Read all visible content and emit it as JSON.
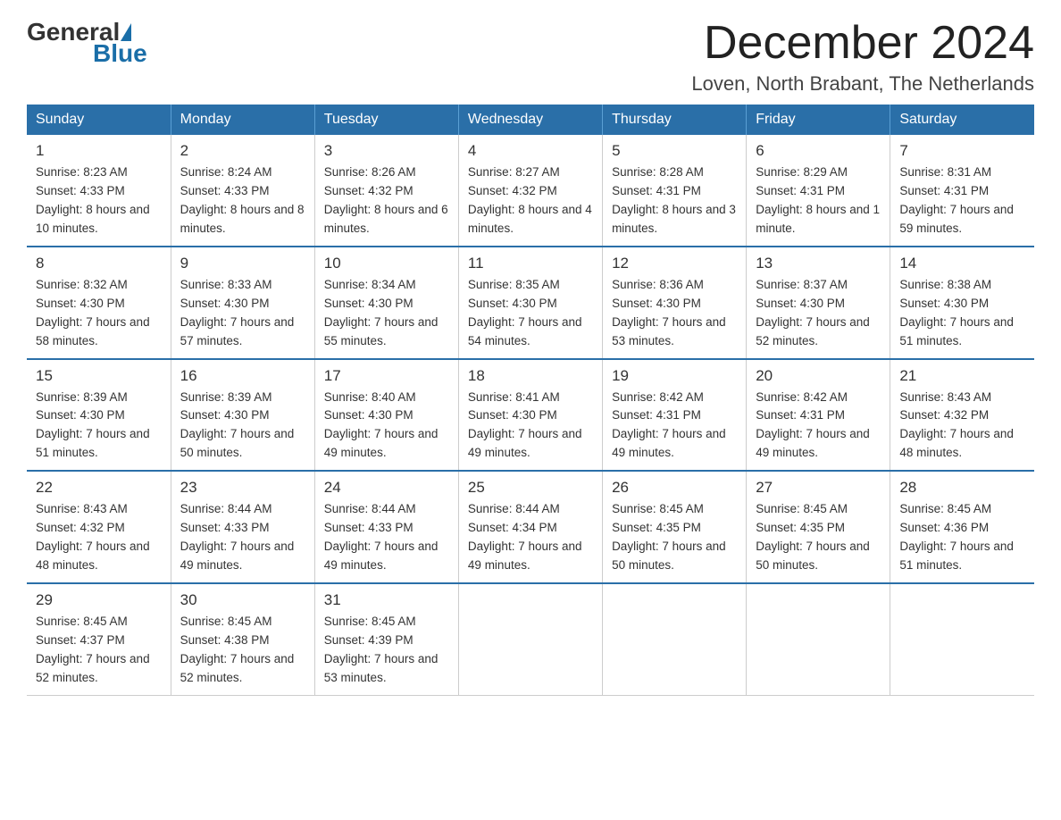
{
  "header": {
    "logo": {
      "part1": "General",
      "part2": "Blue"
    },
    "title": "December 2024",
    "location": "Loven, North Brabant, The Netherlands"
  },
  "weekdays": [
    "Sunday",
    "Monday",
    "Tuesday",
    "Wednesday",
    "Thursday",
    "Friday",
    "Saturday"
  ],
  "weeks": [
    [
      {
        "day": "1",
        "sunrise": "8:23 AM",
        "sunset": "4:33 PM",
        "daylight": "8 hours and 10 minutes."
      },
      {
        "day": "2",
        "sunrise": "8:24 AM",
        "sunset": "4:33 PM",
        "daylight": "8 hours and 8 minutes."
      },
      {
        "day": "3",
        "sunrise": "8:26 AM",
        "sunset": "4:32 PM",
        "daylight": "8 hours and 6 minutes."
      },
      {
        "day": "4",
        "sunrise": "8:27 AM",
        "sunset": "4:32 PM",
        "daylight": "8 hours and 4 minutes."
      },
      {
        "day": "5",
        "sunrise": "8:28 AM",
        "sunset": "4:31 PM",
        "daylight": "8 hours and 3 minutes."
      },
      {
        "day": "6",
        "sunrise": "8:29 AM",
        "sunset": "4:31 PM",
        "daylight": "8 hours and 1 minute."
      },
      {
        "day": "7",
        "sunrise": "8:31 AM",
        "sunset": "4:31 PM",
        "daylight": "7 hours and 59 minutes."
      }
    ],
    [
      {
        "day": "8",
        "sunrise": "8:32 AM",
        "sunset": "4:30 PM",
        "daylight": "7 hours and 58 minutes."
      },
      {
        "day": "9",
        "sunrise": "8:33 AM",
        "sunset": "4:30 PM",
        "daylight": "7 hours and 57 minutes."
      },
      {
        "day": "10",
        "sunrise": "8:34 AM",
        "sunset": "4:30 PM",
        "daylight": "7 hours and 55 minutes."
      },
      {
        "day": "11",
        "sunrise": "8:35 AM",
        "sunset": "4:30 PM",
        "daylight": "7 hours and 54 minutes."
      },
      {
        "day": "12",
        "sunrise": "8:36 AM",
        "sunset": "4:30 PM",
        "daylight": "7 hours and 53 minutes."
      },
      {
        "day": "13",
        "sunrise": "8:37 AM",
        "sunset": "4:30 PM",
        "daylight": "7 hours and 52 minutes."
      },
      {
        "day": "14",
        "sunrise": "8:38 AM",
        "sunset": "4:30 PM",
        "daylight": "7 hours and 51 minutes."
      }
    ],
    [
      {
        "day": "15",
        "sunrise": "8:39 AM",
        "sunset": "4:30 PM",
        "daylight": "7 hours and 51 minutes."
      },
      {
        "day": "16",
        "sunrise": "8:39 AM",
        "sunset": "4:30 PM",
        "daylight": "7 hours and 50 minutes."
      },
      {
        "day": "17",
        "sunrise": "8:40 AM",
        "sunset": "4:30 PM",
        "daylight": "7 hours and 49 minutes."
      },
      {
        "day": "18",
        "sunrise": "8:41 AM",
        "sunset": "4:30 PM",
        "daylight": "7 hours and 49 minutes."
      },
      {
        "day": "19",
        "sunrise": "8:42 AM",
        "sunset": "4:31 PM",
        "daylight": "7 hours and 49 minutes."
      },
      {
        "day": "20",
        "sunrise": "8:42 AM",
        "sunset": "4:31 PM",
        "daylight": "7 hours and 49 minutes."
      },
      {
        "day": "21",
        "sunrise": "8:43 AM",
        "sunset": "4:32 PM",
        "daylight": "7 hours and 48 minutes."
      }
    ],
    [
      {
        "day": "22",
        "sunrise": "8:43 AM",
        "sunset": "4:32 PM",
        "daylight": "7 hours and 48 minutes."
      },
      {
        "day": "23",
        "sunrise": "8:44 AM",
        "sunset": "4:33 PM",
        "daylight": "7 hours and 49 minutes."
      },
      {
        "day": "24",
        "sunrise": "8:44 AM",
        "sunset": "4:33 PM",
        "daylight": "7 hours and 49 minutes."
      },
      {
        "day": "25",
        "sunrise": "8:44 AM",
        "sunset": "4:34 PM",
        "daylight": "7 hours and 49 minutes."
      },
      {
        "day": "26",
        "sunrise": "8:45 AM",
        "sunset": "4:35 PM",
        "daylight": "7 hours and 50 minutes."
      },
      {
        "day": "27",
        "sunrise": "8:45 AM",
        "sunset": "4:35 PM",
        "daylight": "7 hours and 50 minutes."
      },
      {
        "day": "28",
        "sunrise": "8:45 AM",
        "sunset": "4:36 PM",
        "daylight": "7 hours and 51 minutes."
      }
    ],
    [
      {
        "day": "29",
        "sunrise": "8:45 AM",
        "sunset": "4:37 PM",
        "daylight": "7 hours and 52 minutes."
      },
      {
        "day": "30",
        "sunrise": "8:45 AM",
        "sunset": "4:38 PM",
        "daylight": "7 hours and 52 minutes."
      },
      {
        "day": "31",
        "sunrise": "8:45 AM",
        "sunset": "4:39 PM",
        "daylight": "7 hours and 53 minutes."
      },
      null,
      null,
      null,
      null
    ]
  ]
}
